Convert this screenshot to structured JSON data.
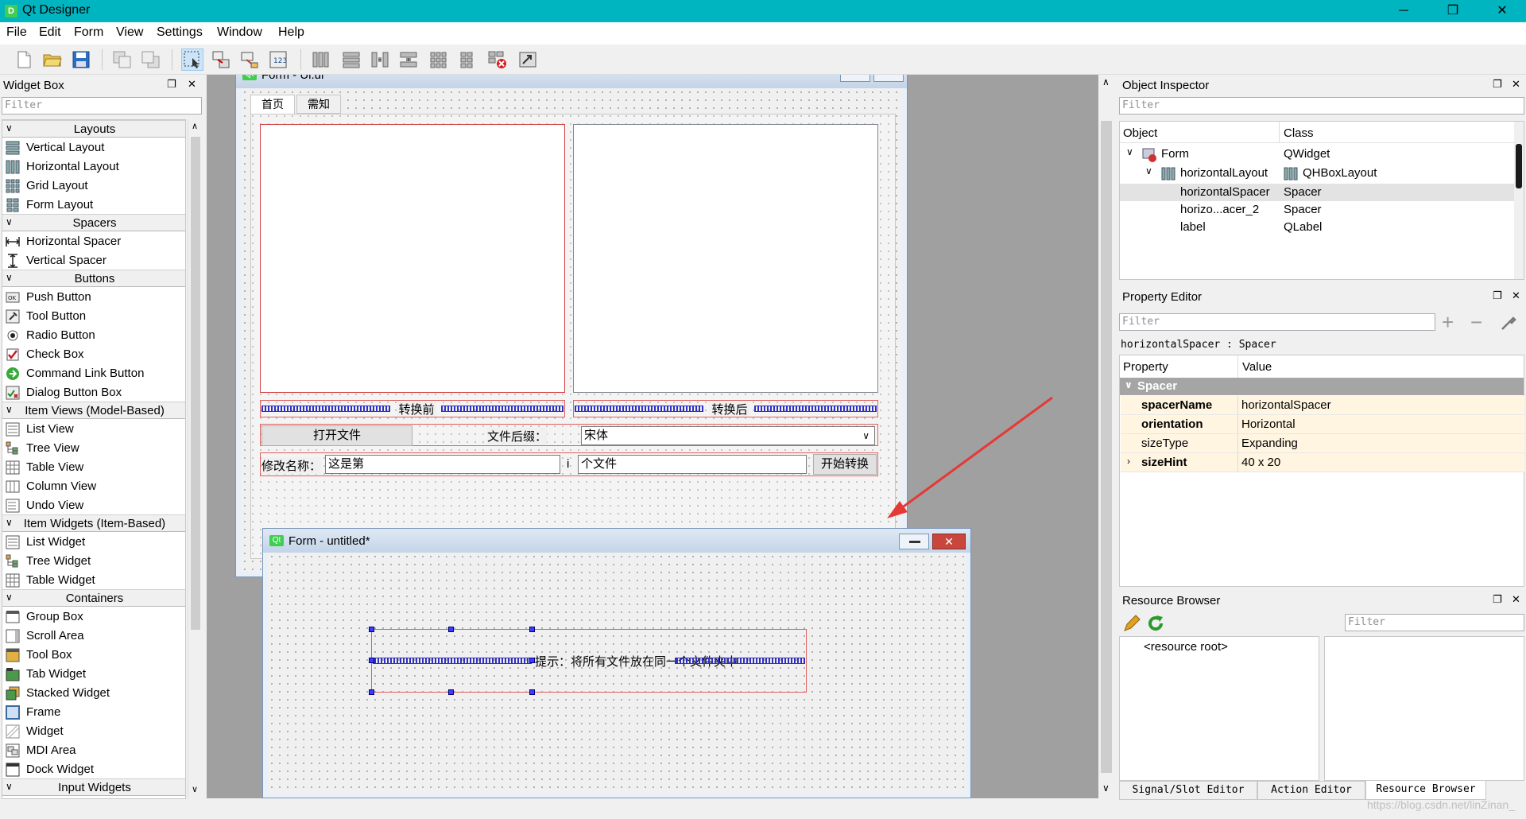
{
  "window": {
    "title": "Qt Designer",
    "minimize": "─",
    "maximize": "❐",
    "close": "✕"
  },
  "menu": [
    "File",
    "Edit",
    "Form",
    "View",
    "Settings",
    "Window",
    "Help"
  ],
  "widget_box": {
    "title": "Widget Box",
    "filter_placeholder": "Filter",
    "categories": {
      "layouts": "Layouts",
      "spacers": "Spacers",
      "buttons": "Buttons",
      "item_views": "Item Views (Model-Based)",
      "item_widgets": "Item Widgets (Item-Based)",
      "containers": "Containers",
      "input_widgets": "Input Widgets"
    },
    "items": {
      "vertical_layout": "Vertical Layout",
      "horizontal_layout": "Horizontal Layout",
      "grid_layout": "Grid Layout",
      "form_layout": "Form Layout",
      "horizontal_spacer": "Horizontal Spacer",
      "vertical_spacer": "Vertical Spacer",
      "push_button": "Push Button",
      "tool_button": "Tool Button",
      "radio_button": "Radio Button",
      "check_box": "Check Box",
      "command_link_button": "Command Link Button",
      "dialog_button_box": "Dialog Button Box",
      "list_view": "List View",
      "tree_view": "Tree View",
      "table_view": "Table View",
      "column_view": "Column View",
      "undo_view": "Undo View",
      "list_widget": "List Widget",
      "tree_widget": "Tree Widget",
      "table_widget": "Table Widget",
      "group_box": "Group Box",
      "scroll_area": "Scroll Area",
      "tool_box": "Tool Box",
      "tab_widget": "Tab Widget",
      "stacked_widget": "Stacked Widget",
      "frame": "Frame",
      "widget": "Widget",
      "mdi_area": "MDI Area",
      "dock_widget": "Dock Widget"
    }
  },
  "form_ui": {
    "title": "Form - Ui.ui*",
    "tabs": [
      "首页",
      "需知"
    ],
    "label_before": "转换前",
    "label_after": "转换后",
    "open_file_button": "打开文件",
    "suffix_label": "文件后缀：",
    "font_combo_value": "宋体",
    "rename_label": "修改名称：",
    "rename_value": "这是第",
    "index_label": "i",
    "rename_suffix_value": "个文件",
    "start_button": "开始转换"
  },
  "form_untitled": {
    "title": "Form - untitled*",
    "hint_label": "提示：将所有文件放在同一个文件夹中"
  },
  "object_inspector": {
    "title": "Object Inspector",
    "filter_placeholder": "Filter",
    "col_object": "Object",
    "col_class": "Class",
    "rows": [
      {
        "object": "Form",
        "class": "QWidget"
      },
      {
        "object": "horizontalLayout",
        "class": "QHBoxLayout"
      },
      {
        "object": "horizontalSpacer",
        "class": "Spacer"
      },
      {
        "object": "horizo...acer_2",
        "class": "Spacer"
      },
      {
        "object": "label",
        "class": "QLabel"
      }
    ]
  },
  "property_editor": {
    "title": "Property Editor",
    "filter_placeholder": "Filter",
    "selection": "horizontalSpacer : Spacer",
    "col_property": "Property",
    "col_value": "Value",
    "group": "Spacer",
    "rows": [
      {
        "name": "spacerName",
        "value": "horizontalSpacer",
        "bold": true
      },
      {
        "name": "orientation",
        "value": "Horizontal",
        "bold": true
      },
      {
        "name": "sizeType",
        "value": "Expanding",
        "bold": false
      },
      {
        "name": "sizeHint",
        "value": "40 x 20",
        "bold": true
      }
    ]
  },
  "resource_browser": {
    "title": "Resource Browser",
    "filter_placeholder": "Filter",
    "root": "<resource root>"
  },
  "bottom_tabs": [
    "Signal/Slot Editor",
    "Action Editor",
    "Resource Browser"
  ],
  "watermark": "https://blog.csdn.net/linZinan_"
}
